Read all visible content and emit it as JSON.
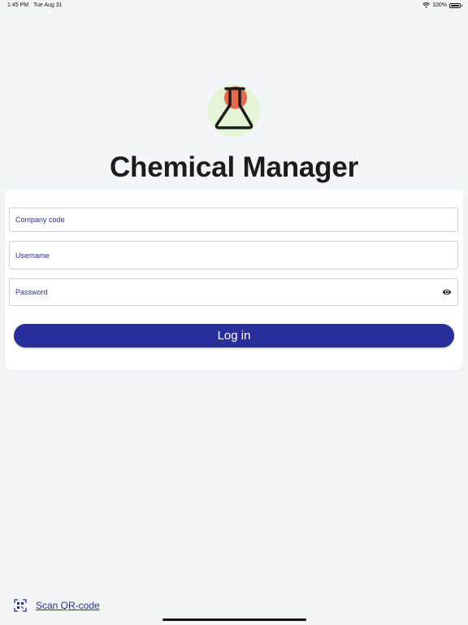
{
  "status_bar": {
    "time": "1:45 PM",
    "date": "Tue Aug 31",
    "battery": "100%",
    "wifi_icon": "wifi-icon",
    "battery_icon": "battery-icon"
  },
  "app": {
    "title": "Chemical Manager",
    "logo_icon": "flask-icon"
  },
  "form": {
    "company_code": {
      "placeholder": "Company code",
      "value": ""
    },
    "username": {
      "placeholder": "Username",
      "value": ""
    },
    "password": {
      "placeholder": "Password",
      "value": "",
      "toggle_icon": "eye-icon"
    },
    "login_label": "Log in"
  },
  "footer": {
    "scan_label": "Scan QR-code",
    "scan_icon": "qr-code-icon"
  },
  "colors": {
    "background": "#f4f5f8",
    "primary": "#282f9b",
    "field_text": "#2a2f8c",
    "logo_circle_green": "#e3f5d4",
    "logo_circle_orange": "#e9694a"
  }
}
